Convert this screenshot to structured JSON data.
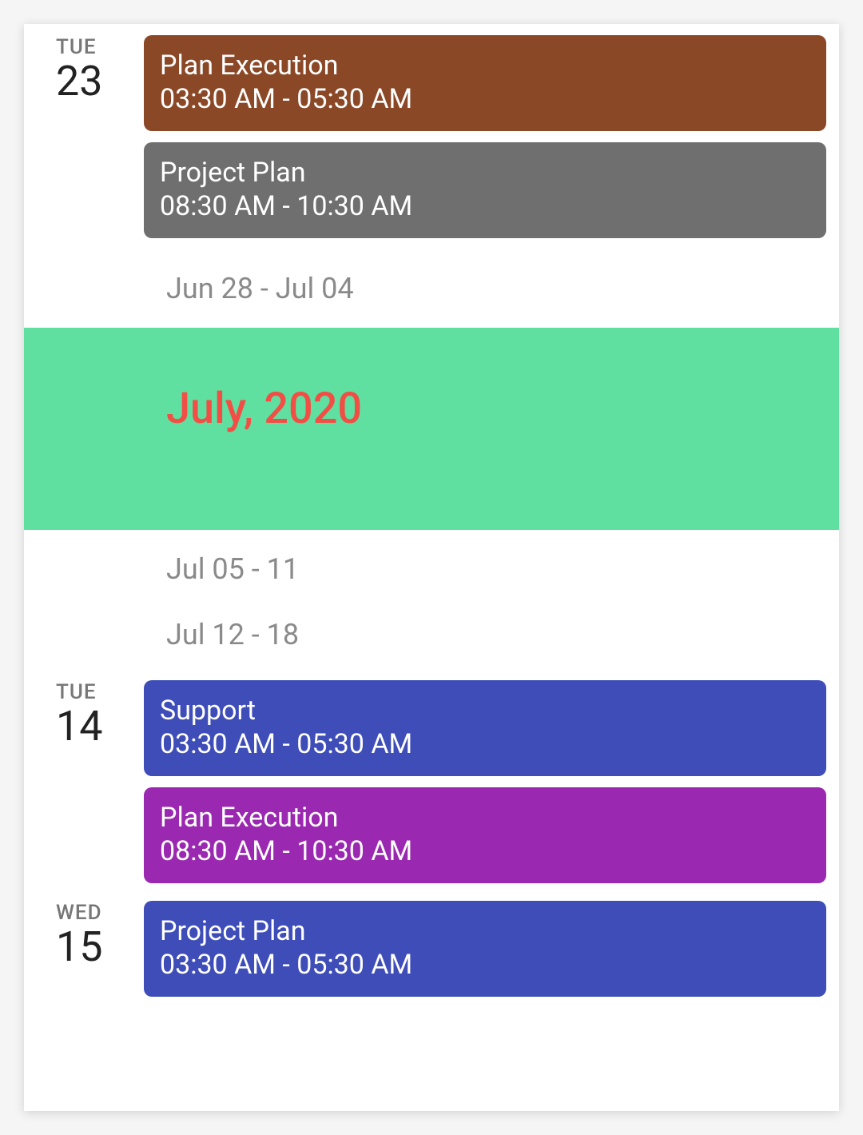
{
  "colors": {
    "brown": "#8B4827",
    "grey": "#6F6F6F",
    "mint": "#5FE0A0",
    "red": "#F24E45",
    "blue": "#3E4DB8",
    "purple": "#9B28B0"
  },
  "days": [
    {
      "weekday": "TUE",
      "day": "23",
      "events": [
        {
          "title": "Plan Execution",
          "time": "03:30 AM - 05:30 AM",
          "colorKey": "brown"
        },
        {
          "title": "Project Plan",
          "time": "08:30 AM - 10:30 AM",
          "colorKey": "grey"
        }
      ]
    }
  ],
  "week_label_1": "Jun 28 - Jul 04",
  "month_header": {
    "label": "July, 2020",
    "bgKey": "mint",
    "fgKey": "red"
  },
  "week_label_2": "Jul 05 - 11",
  "week_label_3": "Jul 12 - 18",
  "days2": [
    {
      "weekday": "TUE",
      "day": "14",
      "events": [
        {
          "title": "Support",
          "time": "03:30 AM - 05:30 AM",
          "colorKey": "blue"
        },
        {
          "title": "Plan Execution",
          "time": "08:30 AM - 10:30 AM",
          "colorKey": "purple"
        }
      ]
    },
    {
      "weekday": "WED",
      "day": "15",
      "events": [
        {
          "title": "Project Plan",
          "time": "03:30 AM - 05:30 AM",
          "colorKey": "blue"
        }
      ]
    }
  ]
}
